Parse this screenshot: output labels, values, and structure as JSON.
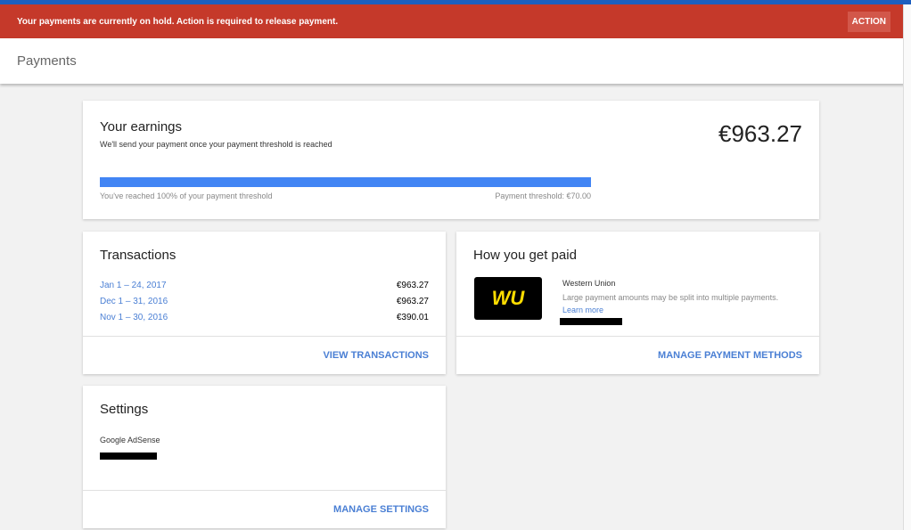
{
  "banner": {
    "message": "Your payments are currently on hold. Action is required to release payment.",
    "action": "ACTION"
  },
  "header": {
    "title": "Payments"
  },
  "earnings": {
    "title": "Your earnings",
    "subtitle": "We'll send your payment once your payment threshold is reached",
    "amount": "€963.27",
    "progress_percent": 100,
    "progress_label": "You've reached 100% of your payment threshold",
    "threshold": "Payment threshold: €70.00",
    "color": "#4285f4"
  },
  "transactions": {
    "title": "Transactions",
    "rows": [
      {
        "period": "Jan 1 – 24, 2017",
        "amount": "€963.27"
      },
      {
        "period": "Dec 1 – 31, 2016",
        "amount": "€963.27"
      },
      {
        "period": "Nov 1 – 30, 2016",
        "amount": "€390.01"
      }
    ],
    "action": "VIEW TRANSACTIONS"
  },
  "paid": {
    "title": "How you get paid",
    "method": "Western Union",
    "note": "Large payment amounts may be split into multiple payments.",
    "learn_more": "Learn more",
    "logo_text": "WU",
    "action": "MANAGE PAYMENT METHODS"
  },
  "settings": {
    "title": "Settings",
    "product": "Google AdSense",
    "action": "MANAGE SETTINGS"
  }
}
